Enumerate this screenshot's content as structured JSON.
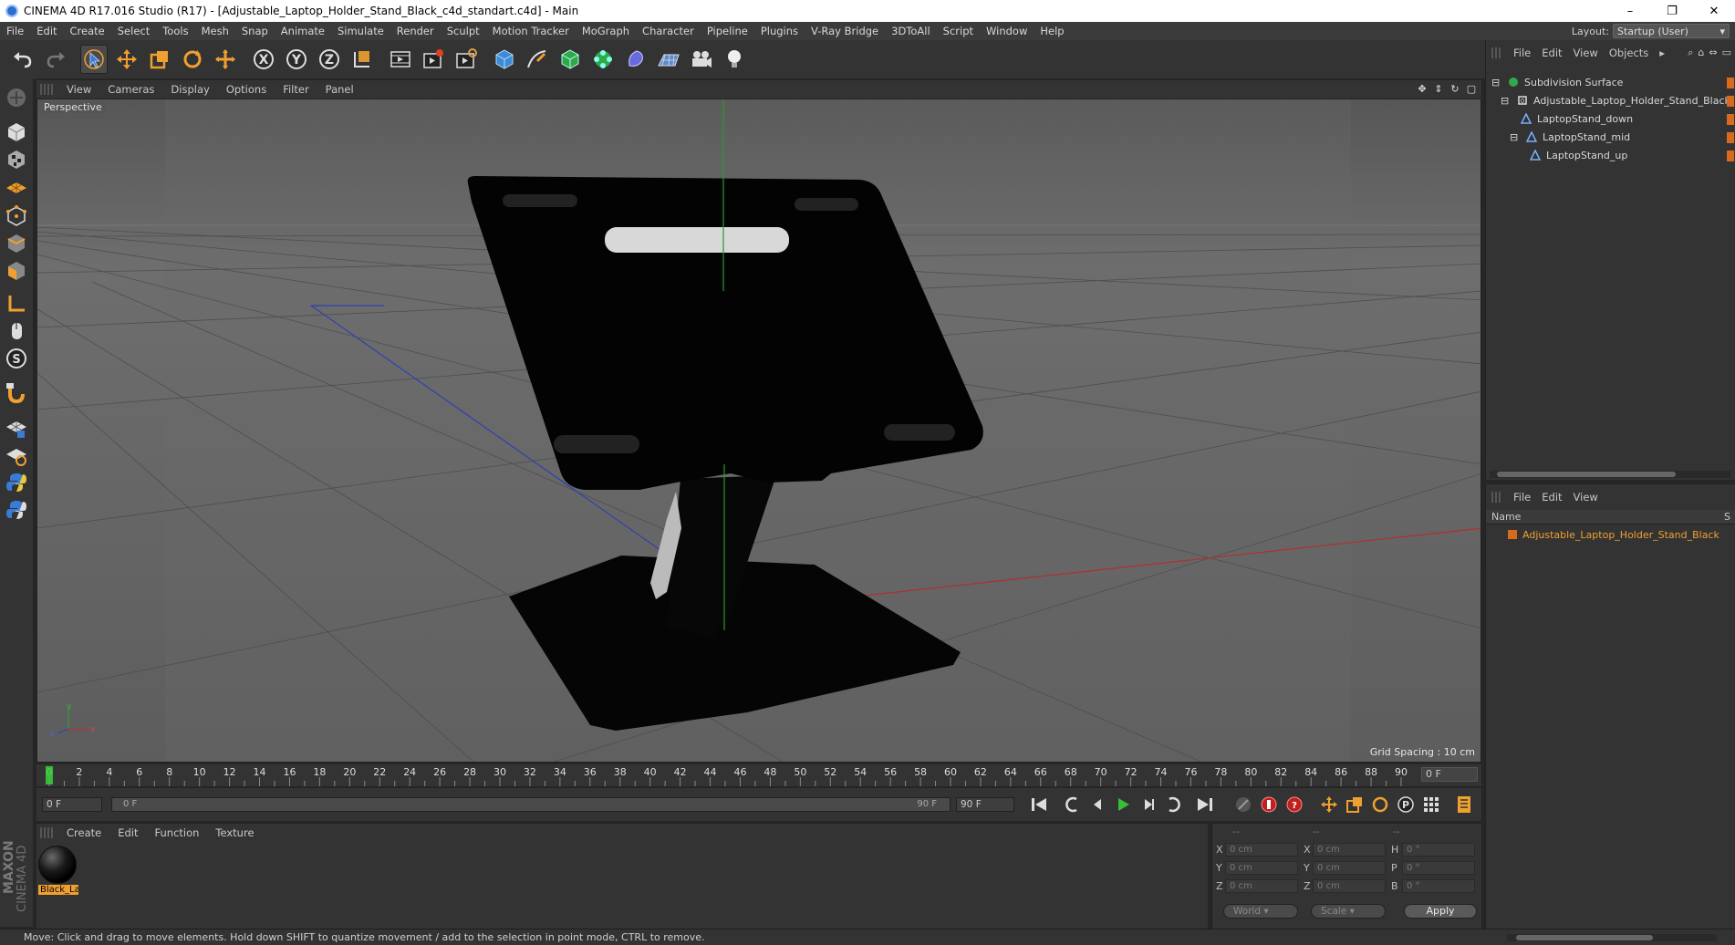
{
  "window": {
    "title": "CINEMA 4D R17.016 Studio (R17) - [Adjustable_Laptop_Holder_Stand_Black_c4d_standart.c4d] - Main",
    "controls": [
      "–",
      "❐",
      "✕"
    ]
  },
  "menubar": {
    "items": [
      "File",
      "Edit",
      "Create",
      "Select",
      "Tools",
      "Mesh",
      "Snap",
      "Animate",
      "Simulate",
      "Render",
      "Sculpt",
      "Motion Tracker",
      "MoGraph",
      "Character",
      "Pipeline",
      "Plugins",
      "V-Ray Bridge",
      "3DToAll",
      "Script",
      "Window",
      "Help"
    ],
    "layout_label": "Layout:",
    "layout_value": "Startup (User)"
  },
  "toolbar": {
    "icons": [
      "undo-icon",
      "redo-icon",
      "select-pointer-icon",
      "move-icon",
      "scale-icon",
      "rotate-icon",
      "live-select-icon",
      "axis-x-icon",
      "axis-y-icon",
      "axis-z-icon",
      "coordinate-system-icon",
      "render-view-icon",
      "render-picture-viewer-icon",
      "edit-render-settings-icon",
      "cube-primitive-icon",
      "pen-spline-icon",
      "subdivision-nurbs-icon",
      "cloner-icon",
      "deformer-icon",
      "floor-icon",
      "camera-icon",
      "light-icon"
    ],
    "axis_labels": [
      "X",
      "Y",
      "Z"
    ]
  },
  "lefttools": {
    "icons": [
      "make-editable-icon",
      "model-mode-icon",
      "texture-mode-icon",
      "workplane-icon",
      "points-mode-icon",
      "edges-mode-icon",
      "polygons-mode-icon",
      "axis-mode-icon",
      "tweak-mode-icon",
      "solo-icon",
      "magnet-snap-icon",
      "grid-snap-icon",
      "lock-workplane-icon",
      "python-icon",
      "python-script-icon"
    ],
    "solo_letter": "S"
  },
  "branding": {
    "maxon": "MAXON",
    "cinema": "CINEMA 4D"
  },
  "viewport": {
    "menu": [
      "View",
      "Cameras",
      "Display",
      "Options",
      "Filter",
      "Panel"
    ],
    "label": "Perspective",
    "grid_spacing": "Grid Spacing : 10 cm",
    "axis_x": "x",
    "axis_y": "y",
    "axis_z": "z"
  },
  "timeline": {
    "ticks": [
      0,
      2,
      4,
      6,
      8,
      10,
      12,
      14,
      16,
      18,
      20,
      22,
      24,
      26,
      28,
      30,
      32,
      34,
      36,
      38,
      40,
      42,
      44,
      46,
      48,
      50,
      52,
      54,
      56,
      58,
      60,
      62,
      64,
      66,
      68,
      70,
      72,
      74,
      76,
      78,
      80,
      82,
      84,
      86,
      88,
      90
    ],
    "current_frame": "0 F"
  },
  "transport": {
    "start_field": "0 F",
    "range_start": "0 F",
    "range_end": "90 F",
    "end_field": "90 F"
  },
  "material_manager": {
    "menu": [
      "Create",
      "Edit",
      "Function",
      "Texture"
    ],
    "material_name": "Black_La"
  },
  "coordinates": {
    "headers": [
      "--",
      "--",
      "--"
    ],
    "rows": [
      {
        "a1": "X",
        "v1": "0 cm",
        "a2": "X",
        "v2": "0 cm",
        "a3": "H",
        "v3": "0 °"
      },
      {
        "a1": "Y",
        "v1": "0 cm",
        "a2": "Y",
        "v2": "0 cm",
        "a3": "P",
        "v3": "0 °"
      },
      {
        "a1": "Z",
        "v1": "0 cm",
        "a2": "Z",
        "v2": "0 cm",
        "a3": "B",
        "v3": "0 °"
      }
    ],
    "world": "World",
    "scale": "Scale",
    "apply": "Apply"
  },
  "object_manager": {
    "menu": [
      "File",
      "Edit",
      "View",
      "Objects"
    ],
    "tree": [
      {
        "name": "Subdivision Surface",
        "indent": 0
      },
      {
        "name": "Adjustable_Laptop_Holder_Stand_Black",
        "indent": 1
      },
      {
        "name": "LaptopStand_down",
        "indent": 2
      },
      {
        "name": "LaptopStand_mid",
        "indent": 2
      },
      {
        "name": "LaptopStand_up",
        "indent": 3
      }
    ]
  },
  "attribute_manager": {
    "menu": [
      "File",
      "Edit",
      "View"
    ],
    "col_name": "Name",
    "col_s": "S",
    "item": "Adjustable_Laptop_Holder_Stand_Black"
  },
  "statusbar": {
    "text": "Move: Click and drag to move elements. Hold down SHIFT to quantize movement / add to the selection in point mode, CTRL to remove."
  },
  "colors": {
    "accent_orange": "#f0a030",
    "tag_orange": "#d86a1e",
    "axis_x": "#c03030",
    "axis_y": "#30a030",
    "axis_z": "#3040c0",
    "viewport_bg": "#5f5f5f"
  }
}
